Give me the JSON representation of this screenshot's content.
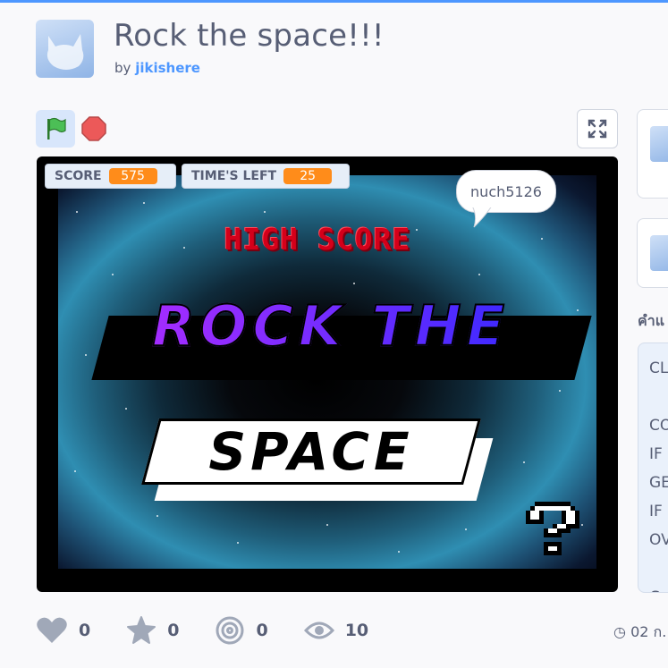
{
  "project": {
    "title": "Rock the space!!!",
    "by_label": "by",
    "author": "jikishere"
  },
  "controls": {
    "flag_icon": "green-flag-icon",
    "stop_icon": "stop-icon",
    "fullscreen_icon": "fullscreen-icon"
  },
  "stage": {
    "monitors": [
      {
        "label": "SCORE",
        "value": "575"
      },
      {
        "label": "TIME'S LEFT",
        "value": "25"
      }
    ],
    "speech_bubble": "nuch5126",
    "high_score_text": "HIGH SCORE",
    "title_line1": "ROCK THE",
    "title_line2": "SPACE",
    "help_icon": "question-mark-icon"
  },
  "stats": {
    "loves": "0",
    "favorites": "0",
    "remixes": "0",
    "views": "10",
    "date": "02 ก."
  },
  "sidebar": {
    "heading": "คำแ",
    "instructions_lines": [
      "CL",
      "",
      "CO",
      "IF",
      "GE",
      "IF",
      "OV",
      "",
      "C"
    ]
  },
  "colors": {
    "accent": "#4d97ff",
    "monitor_value": "#ff8c1a",
    "text": "#575e75"
  }
}
